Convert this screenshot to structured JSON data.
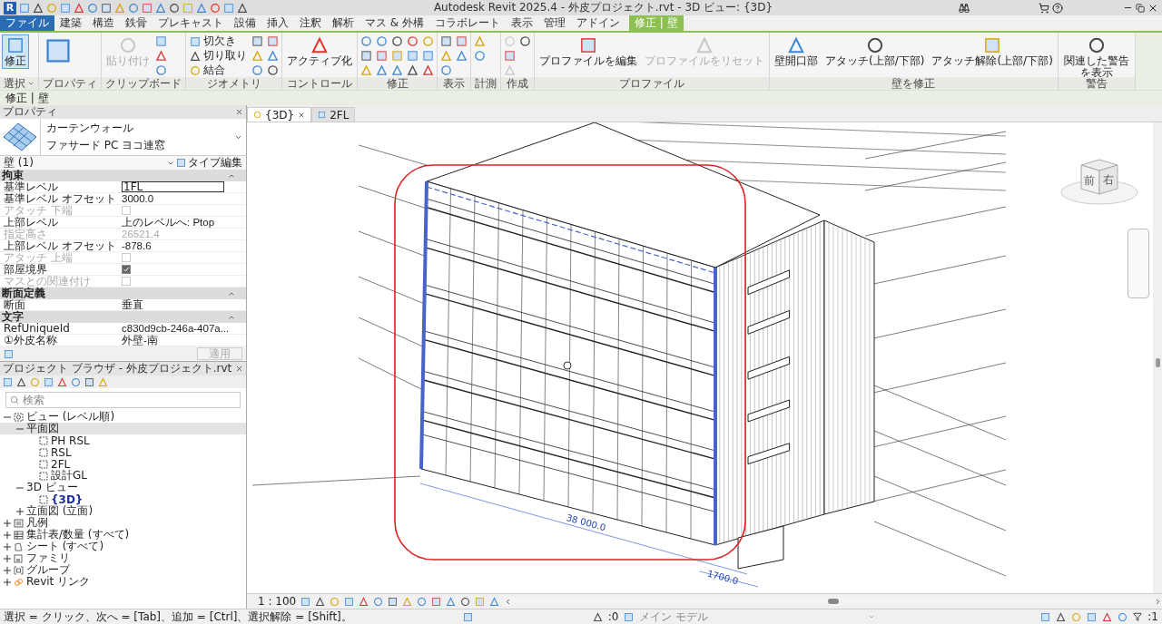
{
  "app": {
    "logo": "R",
    "title": "Autodesk Revit 2025.4 - 外皮プロジェクト.rvt - 3D ビュー: {3D}"
  },
  "ribbon_tabs": [
    {
      "label": "ファイル",
      "kind": "file",
      "selected": false
    },
    {
      "label": "建築",
      "kind": "normal",
      "selected": false
    },
    {
      "label": "構造",
      "kind": "normal",
      "selected": false
    },
    {
      "label": "鉄骨",
      "kind": "normal",
      "selected": false
    },
    {
      "label": "プレキャスト",
      "kind": "normal",
      "selected": false
    },
    {
      "label": "設備",
      "kind": "normal",
      "selected": false
    },
    {
      "label": "挿入",
      "kind": "normal",
      "selected": false
    },
    {
      "label": "注釈",
      "kind": "normal",
      "selected": false
    },
    {
      "label": "解析",
      "kind": "normal",
      "selected": false
    },
    {
      "label": "マス & 外構",
      "kind": "normal",
      "selected": false
    },
    {
      "label": "コラボレート",
      "kind": "normal",
      "selected": false
    },
    {
      "label": "表示",
      "kind": "normal",
      "selected": false
    },
    {
      "label": "管理",
      "kind": "normal",
      "selected": false
    },
    {
      "label": "アドイン",
      "kind": "normal",
      "selected": false
    },
    {
      "label": "修正 | 壁",
      "kind": "contextual",
      "selected": true
    }
  ],
  "ribbon_panels": [
    {
      "title": "選択",
      "tools": [
        {
          "kind": "large",
          "label": "修正",
          "selected": true,
          "disabled": false
        }
      ]
    },
    {
      "title": "プロパティ",
      "tools": [
        {
          "kind": "large-icon",
          "selected": false,
          "disabled": false
        }
      ]
    },
    {
      "title": "クリップボード",
      "tools": [
        {
          "kind": "large",
          "label": "貼り付け",
          "selected": false,
          "disabled": true
        },
        {
          "kind": "icon",
          "selected": false,
          "disabled": false
        },
        {
          "kind": "icon",
          "selected": false,
          "disabled": false
        },
        {
          "kind": "icon",
          "selected": false,
          "disabled": false
        }
      ]
    },
    {
      "title": "ジオメトリ",
      "tools": [
        {
          "kind": "small",
          "label": "切欠き",
          "selected": false,
          "disabled": false
        },
        {
          "kind": "small",
          "label": "切り取り",
          "selected": false,
          "disabled": false
        },
        {
          "kind": "small",
          "label": "結合",
          "selected": false,
          "disabled": false
        },
        {
          "kind": "icon",
          "selected": false,
          "disabled": false
        },
        {
          "kind": "icon",
          "selected": false,
          "disabled": false
        },
        {
          "kind": "icon",
          "selected": false,
          "disabled": false
        },
        {
          "kind": "icon",
          "selected": false,
          "disabled": false
        },
        {
          "kind": "icon",
          "selected": false,
          "disabled": false
        },
        {
          "kind": "icon",
          "selected": false,
          "disabled": false
        }
      ]
    },
    {
      "title": "コントロール",
      "tools": [
        {
          "kind": "large",
          "label": "アクティブ化",
          "selected": false,
          "disabled": false
        }
      ]
    },
    {
      "title": "修正",
      "tools": [
        {
          "kind": "icon",
          "selected": false,
          "disabled": false
        },
        {
          "kind": "icon",
          "selected": false,
          "disabled": false
        },
        {
          "kind": "icon",
          "selected": false,
          "disabled": false
        },
        {
          "kind": "icon",
          "selected": false,
          "disabled": false
        },
        {
          "kind": "icon",
          "selected": false,
          "disabled": false
        },
        {
          "kind": "icon",
          "selected": false,
          "disabled": false
        },
        {
          "kind": "icon",
          "selected": false,
          "disabled": false
        },
        {
          "kind": "icon",
          "selected": false,
          "disabled": false
        },
        {
          "kind": "icon",
          "selected": false,
          "disabled": false
        },
        {
          "kind": "icon",
          "selected": false,
          "disabled": false
        },
        {
          "kind": "icon",
          "selected": false,
          "disabled": false
        },
        {
          "kind": "icon",
          "selected": false,
          "disabled": false
        },
        {
          "kind": "icon",
          "selected": false,
          "disabled": false
        },
        {
          "kind": "icon",
          "selected": false,
          "disabled": false
        },
        {
          "kind": "icon",
          "selected": false,
          "disabled": false
        }
      ]
    },
    {
      "title": "表示",
      "tools": [
        {
          "kind": "icon",
          "selected": false,
          "disabled": false
        },
        {
          "kind": "icon",
          "selected": false,
          "disabled": false
        },
        {
          "kind": "icon",
          "selected": false,
          "disabled": false
        },
        {
          "kind": "icon",
          "selected": false,
          "disabled": false
        },
        {
          "kind": "icon",
          "selected": false,
          "disabled": false
        }
      ]
    },
    {
      "title": "計測",
      "tools": [
        {
          "kind": "icon",
          "selected": false,
          "disabled": false
        },
        {
          "kind": "icon",
          "selected": false,
          "disabled": false
        }
      ]
    },
    {
      "title": "作成",
      "tools": [
        {
          "kind": "icon",
          "selected": false,
          "disabled": true
        },
        {
          "kind": "icon",
          "selected": false,
          "disabled": false
        },
        {
          "kind": "icon",
          "selected": false,
          "disabled": true
        },
        {
          "kind": "icon",
          "selected": false,
          "disabled": false
        }
      ]
    },
    {
      "title": "プロファイル",
      "tools": [
        {
          "kind": "large",
          "label": "プロファイルを編集",
          "selected": false,
          "disabled": false
        },
        {
          "kind": "large",
          "label": "プロファイルをリセット",
          "selected": false,
          "disabled": true
        }
      ]
    },
    {
      "title": "壁を修正",
      "tools": [
        {
          "kind": "large",
          "label": "壁開口部",
          "selected": false,
          "disabled": false
        },
        {
          "kind": "large",
          "label": "アタッチ(上部/下部)",
          "selected": false,
          "disabled": false
        },
        {
          "kind": "large",
          "label": "アタッチ解除(上部/下部)",
          "selected": false,
          "disabled": false
        }
      ]
    },
    {
      "title": "警告",
      "tools": [
        {
          "kind": "large",
          "label": "関連した警告を表示",
          "selected": false,
          "disabled": false
        }
      ]
    }
  ],
  "context_bar": {
    "label": "修正 | 壁"
  },
  "properties": {
    "title": "プロパティ",
    "type_family": "カーテンウォール",
    "type_name": "ファサード PC ヨコ連窓",
    "selector": "壁 (1)",
    "edit_type": "タイプ編集",
    "groups": [
      {
        "title": "拘束",
        "rows": [
          {
            "label": "基準レベル",
            "value": "1FL",
            "kind": "input",
            "disabled": false
          },
          {
            "label": "基準レベル オフセット",
            "value": "3000.0",
            "kind": "text",
            "disabled": false
          },
          {
            "label": "アタッチ 下端",
            "kind": "checkbox",
            "checked": false,
            "disabled": true
          },
          {
            "label": "上部レベル",
            "value": "上のレベルへ: Ptop",
            "kind": "text",
            "disabled": false
          },
          {
            "label": "指定高さ",
            "value": "26521.4",
            "kind": "text",
            "disabled": true
          },
          {
            "label": "上部レベル オフセット",
            "value": "-878.6",
            "kind": "text",
            "disabled": false
          },
          {
            "label": "アタッチ 上端",
            "kind": "checkbox",
            "checked": false,
            "disabled": true
          },
          {
            "label": "部屋境界",
            "kind": "checkbox",
            "checked": true,
            "disabled": false
          },
          {
            "label": "マスとの関連付け",
            "kind": "checkbox",
            "checked": false,
            "disabled": true
          }
        ]
      },
      {
        "title": "断面定義",
        "rows": [
          {
            "label": "断面",
            "value": "垂直",
            "kind": "text",
            "disabled": false
          }
        ]
      },
      {
        "title": "文字",
        "rows": [
          {
            "label": "RefUniqueId",
            "value": "c830d9cb-246a-407a...",
            "kind": "text",
            "disabled": false
          },
          {
            "label": "①外皮名称",
            "value": "外壁-南",
            "kind": "text",
            "disabled": false
          }
        ]
      }
    ],
    "apply": "適用"
  },
  "project_browser": {
    "title": "プロジェクト ブラウザ - 外皮プロジェクト.rvt",
    "search_placeholder": "検索",
    "tree": [
      {
        "label": "ビュー (レベル順)",
        "kind": "views",
        "expanded": true,
        "selected": false,
        "current": false,
        "children": [
          {
            "label": "平面図",
            "expanded": true,
            "selected": true,
            "current": false,
            "children": [
              {
                "label": "PH RSL",
                "kind": "view",
                "selected": false,
                "current": false
              },
              {
                "label": "RSL",
                "kind": "view",
                "selected": false,
                "current": false
              },
              {
                "label": "2FL",
                "kind": "view",
                "selected": false,
                "current": false
              },
              {
                "label": "設計GL",
                "kind": "view",
                "selected": false,
                "current": false
              }
            ]
          },
          {
            "label": "3D ビュー",
            "expanded": true,
            "selected": false,
            "current": false,
            "children": [
              {
                "label": "{3D}",
                "kind": "view",
                "selected": false,
                "current": true
              }
            ]
          },
          {
            "label": "立面図 (立面)",
            "expanded": false,
            "selected": false,
            "current": false
          }
        ]
      },
      {
        "label": "凡例",
        "kind": "legend",
        "expanded": false,
        "selected": false,
        "current": false
      },
      {
        "label": "集計表/数量 (すべて)",
        "kind": "schedule",
        "expanded": false,
        "selected": false,
        "current": false
      },
      {
        "label": "シート (すべて)",
        "kind": "sheet",
        "expanded": false,
        "selected": false,
        "current": false
      },
      {
        "label": "ファミリ",
        "kind": "family",
        "expanded": false,
        "selected": false,
        "current": false
      },
      {
        "label": "グループ",
        "kind": "group",
        "expanded": false,
        "selected": false,
        "current": false
      },
      {
        "label": "Revit リンク",
        "kind": "link",
        "expanded": false,
        "selected": false,
        "current": false
      }
    ]
  },
  "view_tabs": [
    {
      "label": "{3D}",
      "selected": true
    },
    {
      "label": "2FL",
      "selected": false
    }
  ],
  "viewport": {
    "dimension_long": "38 000.0",
    "dimension_short": "1700.0",
    "view_cube": {
      "front": "前",
      "right": "右"
    }
  },
  "view_control_bar": {
    "scale": "1 : 100"
  },
  "status_bar": {
    "hint": "選択 = クリック、次へ = [Tab]、追加 = [Ctrl]、選択解除 = [Shift]。",
    "worksets": ":0",
    "model": "メイン モデル",
    "filter_count": ":1"
  }
}
